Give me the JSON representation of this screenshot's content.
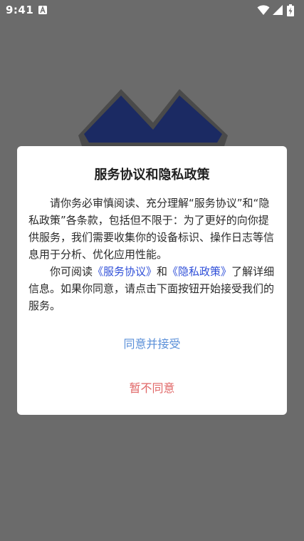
{
  "status_bar": {
    "time": "9:41",
    "left_icon": "a-notification-icon",
    "icons": [
      "wifi-icon",
      "cellular-signal-icon",
      "battery-charging-icon"
    ]
  },
  "background": {
    "logo_icon": "double-peak-logo-icon",
    "logo_color": "#1b2a63"
  },
  "dialog": {
    "title": "服务协议和隐私政策",
    "paragraph1": "请你务必审慎阅读、充分理解“服务协议”和“隐私政策”各条款，包括但不限于：为了更好的向你提供服务，我们需要收集你的设备标识、操作日志等信息用于分析、优化应用性能。",
    "paragraph2_prefix": "你可阅读",
    "service_agreement_link": "《服务协议》",
    "conjunction": "和",
    "privacy_policy_link": "《隐私政策》",
    "paragraph2_suffix": "了解详细信息。如果你同意，请点击下面按钮开始接受我们的服务。",
    "agree_button": "同意并接受",
    "decline_button": "暂不同意"
  },
  "colors": {
    "link": "#2f4fd8",
    "agree": "#5a8fd8",
    "decline": "#e06666",
    "overlay": "#6b6b6b"
  }
}
